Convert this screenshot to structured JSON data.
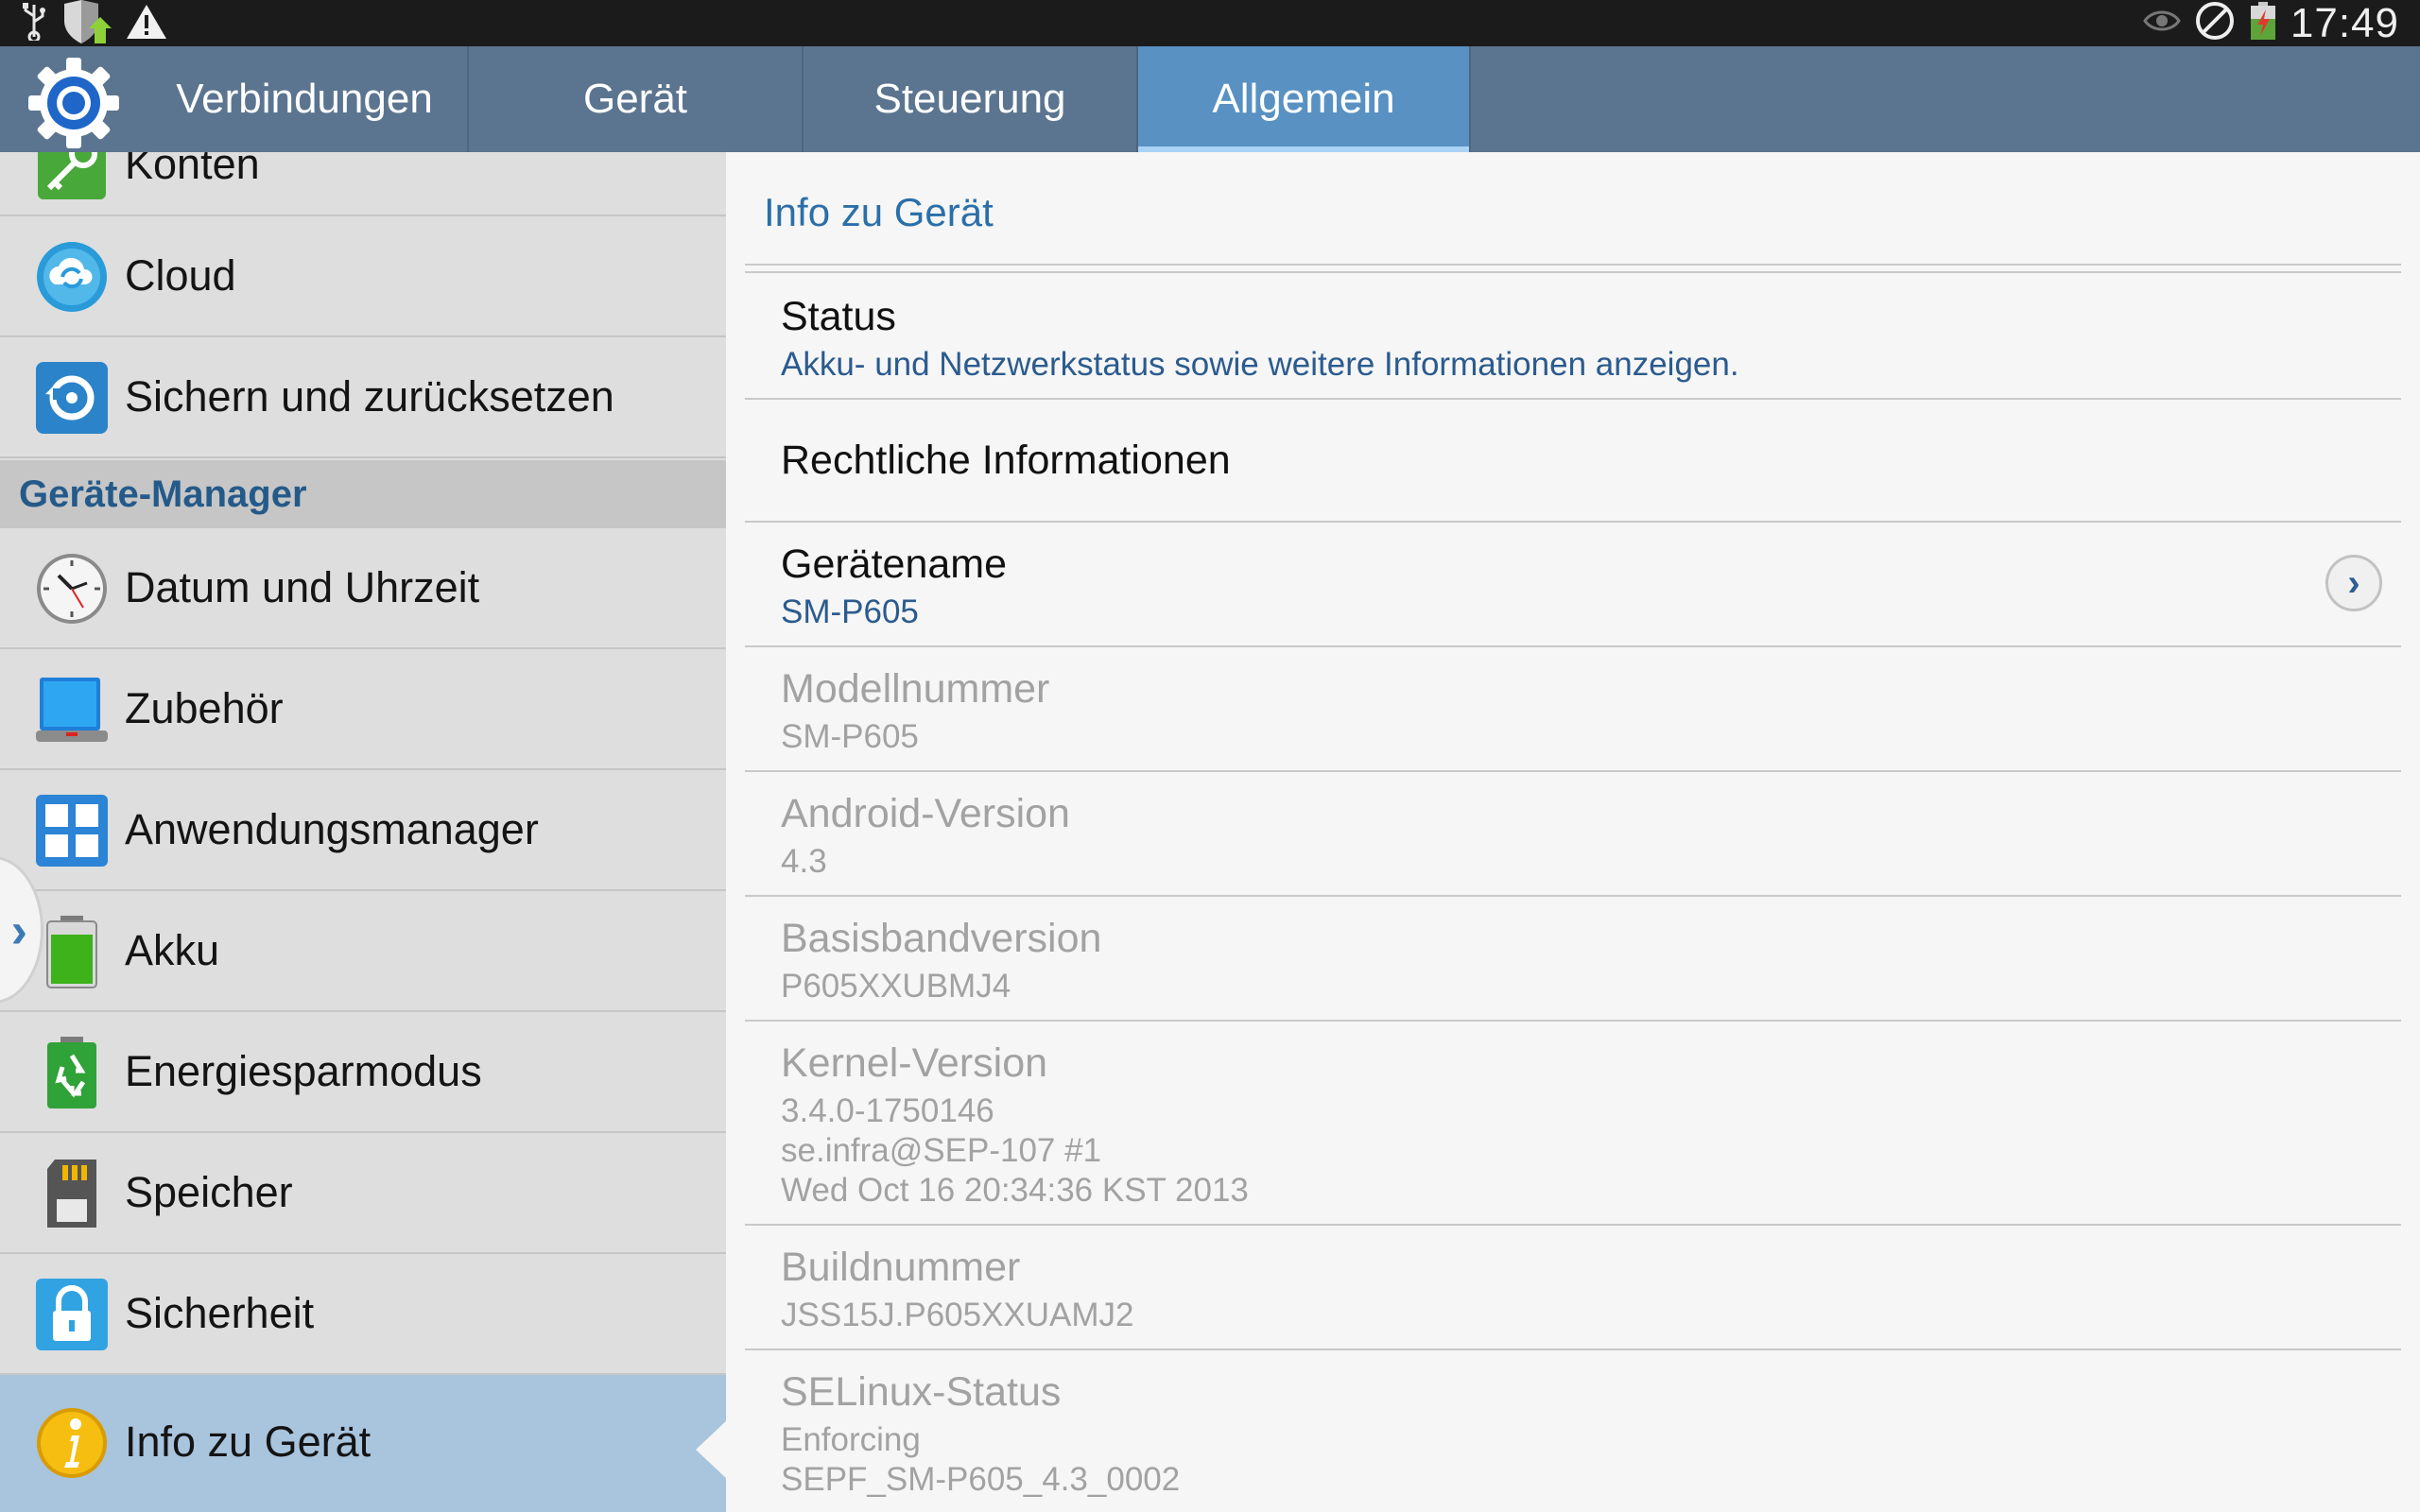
{
  "status_bar": {
    "time": "17:49",
    "left_icons": [
      "usb-icon",
      "shield-update-icon",
      "warning-icon"
    ],
    "right_icons": [
      "eye-icon",
      "no-entry-icon",
      "battery-charging-icon"
    ]
  },
  "tabs": [
    {
      "label": "Verbindungen",
      "active": false
    },
    {
      "label": "Gerät",
      "active": false
    },
    {
      "label": "Steuerung",
      "active": false
    },
    {
      "label": "Allgemein",
      "active": true
    }
  ],
  "sidebar": {
    "items_top": [
      {
        "label": "Konten",
        "icon": "key-icon"
      },
      {
        "label": "Cloud",
        "icon": "cloud-icon"
      },
      {
        "label": "Sichern und zurücksetzen",
        "icon": "backup-restore-icon"
      }
    ],
    "section_header": "Geräte-Manager",
    "items": [
      {
        "label": "Datum und Uhrzeit",
        "icon": "clock-icon"
      },
      {
        "label": "Zubehör",
        "icon": "accessory-icon"
      },
      {
        "label": "Anwendungsmanager",
        "icon": "app-manager-icon"
      },
      {
        "label": "Akku",
        "icon": "battery-icon"
      },
      {
        "label": "Energiesparmodus",
        "icon": "power-saving-icon"
      },
      {
        "label": "Speicher",
        "icon": "storage-icon"
      },
      {
        "label": "Sicherheit",
        "icon": "lock-icon"
      },
      {
        "label": "Info zu Gerät",
        "icon": "info-icon",
        "selected": true
      }
    ]
  },
  "content": {
    "title": "Info zu Gerät",
    "status": {
      "title": "Status",
      "subtitle": "Akku- und Netzwerkstatus sowie weitere Informationen anzeigen."
    },
    "legal": {
      "title": "Rechtliche Informationen"
    },
    "device_name": {
      "title": "Gerätename",
      "value": "SM-P605"
    },
    "model_number": {
      "title": "Modellnummer",
      "value": "SM-P605"
    },
    "android_version": {
      "title": "Android-Version",
      "value": "4.3"
    },
    "baseband_version": {
      "title": "Basisbandversion",
      "value": "P605XXUBMJ4"
    },
    "kernel_version": {
      "title": "Kernel-Version",
      "line1": "3.4.0-1750146",
      "line2": "se.infra@SEP-107 #1",
      "line3": "Wed Oct 16 20:34:36 KST 2013"
    },
    "build_number": {
      "title": "Buildnummer",
      "value": "JSS15J.P605XXUAMJ2"
    },
    "selinux_status": {
      "title": "SELinux-Status",
      "line1": "Enforcing",
      "line2": "SEPF_SM-P605_4.3_0002"
    }
  },
  "colors": {
    "tab_bar": "#5b7590",
    "tab_active": "#5891c2",
    "accent_text": "#2b6fa8",
    "sidebar_selected": "#a9c4dd",
    "section_header_text": "#245a8a"
  }
}
